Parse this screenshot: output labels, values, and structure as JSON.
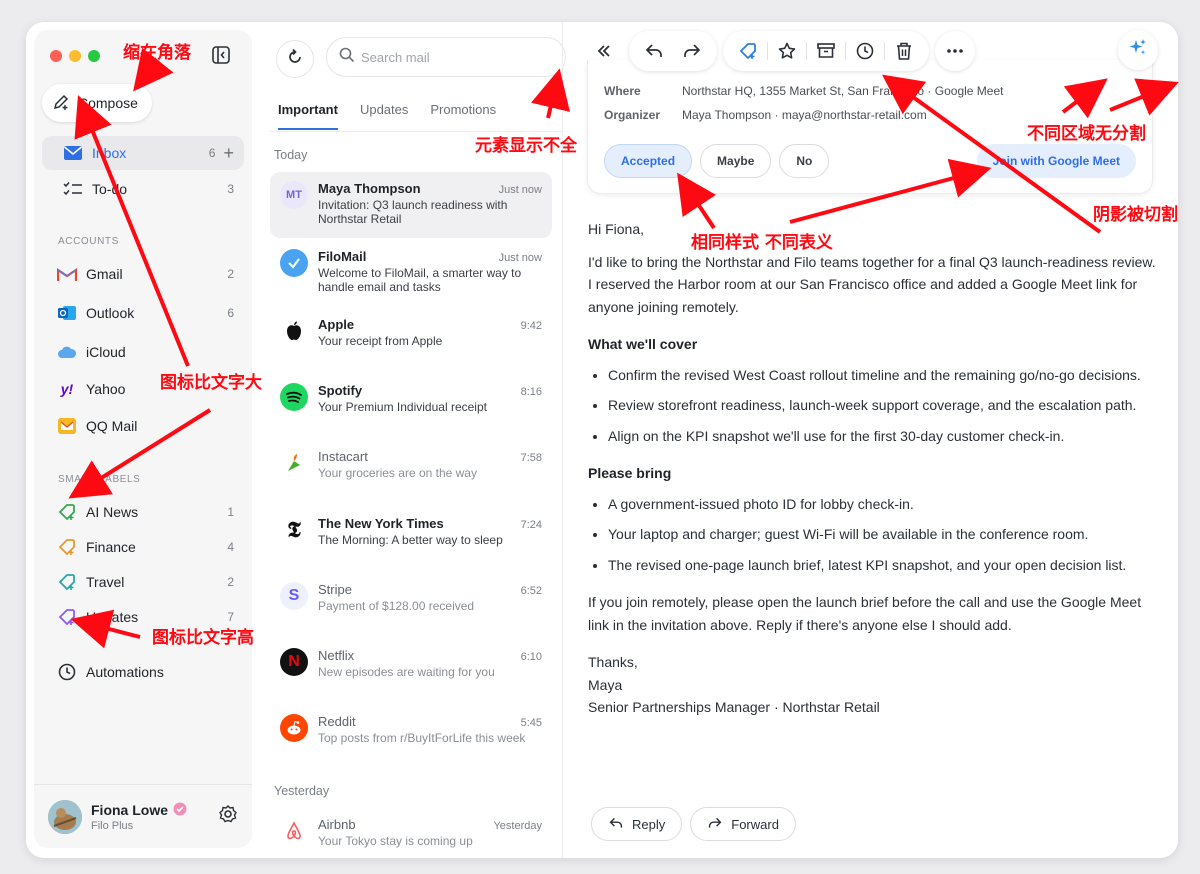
{
  "sidebar": {
    "compose_label": "Compose",
    "nav": [
      {
        "label": "Inbox",
        "count": "6"
      },
      {
        "label": "To-do",
        "count": "3"
      }
    ],
    "accounts_heading": "ACCOUNTS",
    "accounts": [
      {
        "label": "Gmail",
        "count": "2"
      },
      {
        "label": "Outlook",
        "count": "6"
      },
      {
        "label": "iCloud",
        "count": ""
      },
      {
        "label": "Yahoo",
        "count": ""
      },
      {
        "label": "QQ Mail",
        "count": ""
      }
    ],
    "smart_heading": "SMART LABELS",
    "smart_labels": [
      {
        "label": "AI News",
        "count": "1",
        "color": "#3aa655"
      },
      {
        "label": "Finance",
        "count": "4",
        "color": "#e89a2c"
      },
      {
        "label": "Travel",
        "count": "2",
        "color": "#2aa9a0"
      },
      {
        "label": "Updates",
        "count": "7",
        "color": "#8b5cf6"
      }
    ],
    "automations_label": "Automations",
    "user": {
      "name": "Fiona Lowe",
      "plan": "Filo Plus"
    }
  },
  "list": {
    "search_placeholder": "Search mail",
    "tabs": [
      "Important",
      "Updates",
      "Promotions"
    ],
    "group_today": "Today",
    "group_yesterday": "Yesterday",
    "mails": [
      {
        "sender": "Maya Thompson",
        "time": "Just now",
        "subject": "Invitation: Q3 launch readiness with Northstar Retail",
        "initials": "MT"
      },
      {
        "sender": "FiloMail",
        "time": "Just now",
        "subject": "Welcome to FiloMail, a smarter way to handle email and tasks"
      },
      {
        "sender": "Apple",
        "time": "9:42",
        "subject": "Your receipt from Apple"
      },
      {
        "sender": "Spotify",
        "time": "8:16",
        "subject": "Your Premium Individual receipt"
      },
      {
        "sender": "Instacart",
        "time": "7:58",
        "subject": "Your groceries are on the way"
      },
      {
        "sender": "The New York Times",
        "time": "7:24",
        "subject": "The Morning: A better way to sleep"
      },
      {
        "sender": "Stripe",
        "time": "6:52",
        "subject": "Payment of $128.00 received"
      },
      {
        "sender": "Netflix",
        "time": "6:10",
        "subject": "New episodes are waiting for you"
      },
      {
        "sender": "Reddit",
        "time": "5:45",
        "subject": "Top posts from r/BuyItForLife this week"
      },
      {
        "sender": "Airbnb",
        "time": "Yesterday",
        "subject": "Your Tokyo stay is coming up"
      }
    ]
  },
  "reading": {
    "invite": {
      "where_label": "Where",
      "where_value": "Northstar HQ, 1355 Market St, San Francisco · Google Meet",
      "organizer_label": "Organizer",
      "organizer_value": "Maya Thompson · maya@northstar-retail.com",
      "rsvp": [
        "Accepted",
        "Maybe",
        "No"
      ],
      "meet_label": "Join with Google Meet"
    },
    "body": {
      "greeting": "Hi Fiona,",
      "intro": "I'd like to bring the Northstar and Filo teams together for a final Q3 launch-readiness review. I reserved the Harbor room at our San Francisco office and added a Google Meet link for anyone joining remotely.",
      "cover_heading": "What we'll cover",
      "cover_items": [
        "Confirm the revised West Coast rollout timeline and the remaining go/no-go decisions.",
        "Review storefront readiness, launch-week support coverage, and the escalation path.",
        "Align on the KPI snapshot we'll use for the first 30-day customer check-in."
      ],
      "bring_heading": "Please bring",
      "bring_items": [
        "A government-issued photo ID for lobby check-in.",
        "Your laptop and charger; guest Wi-Fi will be available in the conference room.",
        "The revised one-page launch brief, latest KPI snapshot, and your open decision list."
      ],
      "closing": "If you join remotely, please open the launch brief before the call and use the Google Meet link in the invitation above. Reply if there's anyone else I should add.",
      "thanks": "Thanks,",
      "sign_name": "Maya",
      "sign_title": "Senior Partnerships Manager · Northstar Retail"
    },
    "reply_label": "Reply",
    "forward_label": "Forward"
  },
  "annotations": {
    "corner": "缩在角落",
    "incomplete": "元素显示不全",
    "icon_bigger": "图标比文字大",
    "icon_taller": "图标比文字高",
    "no_divide": "不同区域无分割",
    "same_style": "相同样式 不同表义",
    "shadow_cut": "阴影被切割"
  },
  "colors": {
    "accent": "#2f6fe4",
    "annotation": "#ff0a12"
  }
}
